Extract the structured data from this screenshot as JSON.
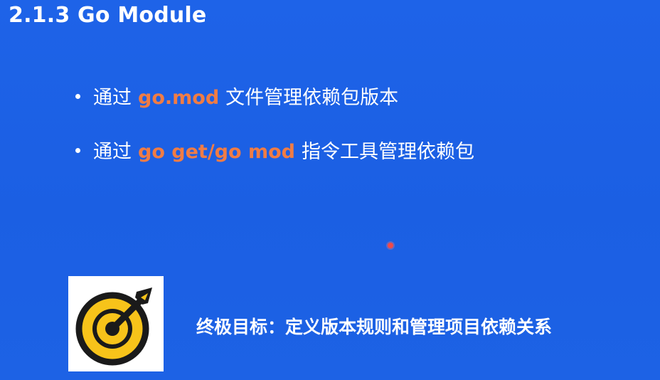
{
  "slide": {
    "title": "2.1.3 Go Module",
    "bullets": [
      {
        "before": "通过",
        "highlight": "go.mod",
        "after": "文件管理依赖包版本"
      },
      {
        "before": "通过",
        "highlight": "go get/go mod",
        "after": "指令工具管理依赖包"
      }
    ],
    "goal": {
      "text": "终极目标：定义版本规则和管理项目依赖关系",
      "icon": "target-arrow-icon"
    }
  },
  "colors": {
    "background": "#1e63e8",
    "highlight": "#f07c45",
    "text": "#ffffff",
    "target_fill": "#f7c31a",
    "target_outline": "#1a1a1a",
    "pointer": "#f04a4a"
  }
}
